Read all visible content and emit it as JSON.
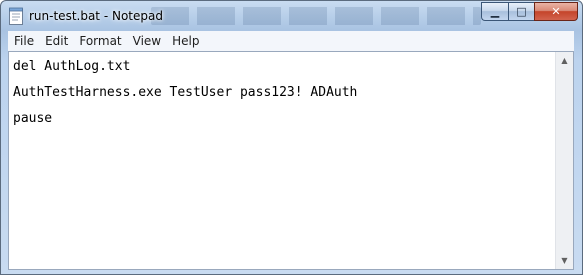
{
  "window": {
    "title": "run-test.bat - Notepad",
    "minimize_glyph": "▁",
    "maximize_glyph": "□",
    "close_glyph": "✕",
    "app_icon": "notepad-icon"
  },
  "menubar": {
    "items": [
      {
        "label": "File"
      },
      {
        "label": "Edit"
      },
      {
        "label": "Format"
      },
      {
        "label": "View"
      },
      {
        "label": "Help"
      }
    ]
  },
  "editor": {
    "lines": [
      "del AuthLog.txt",
      "AuthTestHarness.exe TestUser pass123! ADAuth",
      "pause"
    ]
  },
  "scrollbar": {
    "up_glyph": "▲",
    "down_glyph": "▼"
  }
}
